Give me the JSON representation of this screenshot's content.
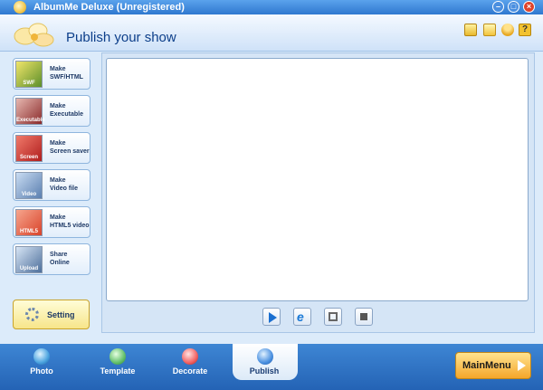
{
  "window": {
    "title": "AlbumMe Deluxe (Unregistered)"
  },
  "header": {
    "title": "Publish your show"
  },
  "publish_options": [
    {
      "line1": "Make",
      "line2": "SWF/HTML",
      "thumb_text": "SWF",
      "thumb_color": "#5c8f2a"
    },
    {
      "line1": "Make",
      "line2": "Executable",
      "thumb_text": "Executable",
      "thumb_color": "#8a2a2a"
    },
    {
      "line1": "Make",
      "line2": "Screen saver",
      "thumb_text": "Screen",
      "thumb_color": "#b01e1e"
    },
    {
      "line1": "Make",
      "line2": "Video file",
      "thumb_text": "Video",
      "thumb_color": "#5a7fb0"
    },
    {
      "line1": "Make",
      "line2": "HTML5 video",
      "thumb_text": "HTML5",
      "thumb_color": "#d9432a"
    },
    {
      "line1": "Share",
      "line2": "Online",
      "thumb_text": "Upload",
      "thumb_color": "#4d6f9b"
    }
  ],
  "setting": {
    "label": "Setting"
  },
  "tabs": [
    {
      "label": "Photo"
    },
    {
      "label": "Template"
    },
    {
      "label": "Decorate"
    },
    {
      "label": "Publish"
    }
  ],
  "main_menu": {
    "label": "MainMenu"
  },
  "icons": {
    "header": [
      "folder-icon",
      "star-icon",
      "person-icon",
      "help-icon"
    ],
    "help_glyph": "?",
    "controls": [
      "play-icon",
      "internet-explorer-icon",
      "fullscreen-icon",
      "stop-icon"
    ]
  },
  "colors": {
    "accent": "#2f78cf",
    "title_text": "#0d3f8a"
  }
}
